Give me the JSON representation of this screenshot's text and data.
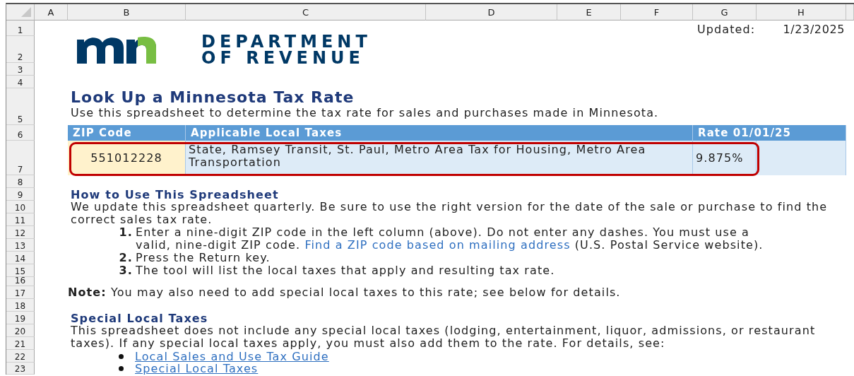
{
  "sheet": {
    "columns": [
      "A",
      "B",
      "C",
      "D",
      "E",
      "F",
      "G",
      "H"
    ],
    "rows": [
      "1",
      "2",
      "3",
      "4",
      "5",
      "6",
      "7",
      "8",
      "9",
      "10",
      "11",
      "12",
      "13",
      "14",
      "15",
      "16",
      "17",
      "18",
      "19",
      "20",
      "21",
      "22",
      "23"
    ]
  },
  "logo": {
    "line1": "DEPARTMENT",
    "line2": "OF REVENUE"
  },
  "updated": {
    "label": "Updated:",
    "date": "1/23/2025"
  },
  "title": "Look Up a Minnesota Tax Rate",
  "subtitle": "Use this spreadsheet to determine the tax rate for sales and purchases made in Minnesota.",
  "lookup_table": {
    "columns": [
      {
        "label": "ZIP Code"
      },
      {
        "label": "Applicable Local Taxes"
      },
      {
        "label": "Rate 01/01/25"
      }
    ],
    "row": {
      "zip_code": "551012228",
      "local_taxes": "State, Ramsey Transit, St. Paul, Metro Area Tax for Housing, Metro Area Transportation",
      "rate": "9.875%",
      "highlighted": true
    }
  },
  "how_to": {
    "heading": "How to Use This Spreadsheet",
    "intro": "We update this spreadsheet quarterly. Be sure to use the right version for the date of the sale or purchase to find the correct sales tax rate.",
    "steps": [
      {
        "number": "1.",
        "text": "Enter a nine-digit ZIP code in the left column (above). Do not enter any dashes. You must use a valid, nine-digit ZIP code.",
        "link": "Find a ZIP code based on mailing address",
        "after": "(U.S. Postal Service website)."
      },
      {
        "number": "2.",
        "text": "Press the Return key."
      },
      {
        "number": "3.",
        "text": "The tool will list the local taxes that apply and resulting tax rate."
      }
    ]
  },
  "note": "**Note:** You may also need to add special local taxes to this rate; see below for details.",
  "special": {
    "heading": "Special Local Taxes",
    "text": "This spreadsheet does not include any special local taxes (lodging, entertainment, liquor, admissions, or restaurant taxes). If any special local taxes apply, you must also add them to the rate. For details, see:",
    "links": [
      "Local Sales and Use Tax Guide",
      "Special Local Taxes"
    ]
  }
}
